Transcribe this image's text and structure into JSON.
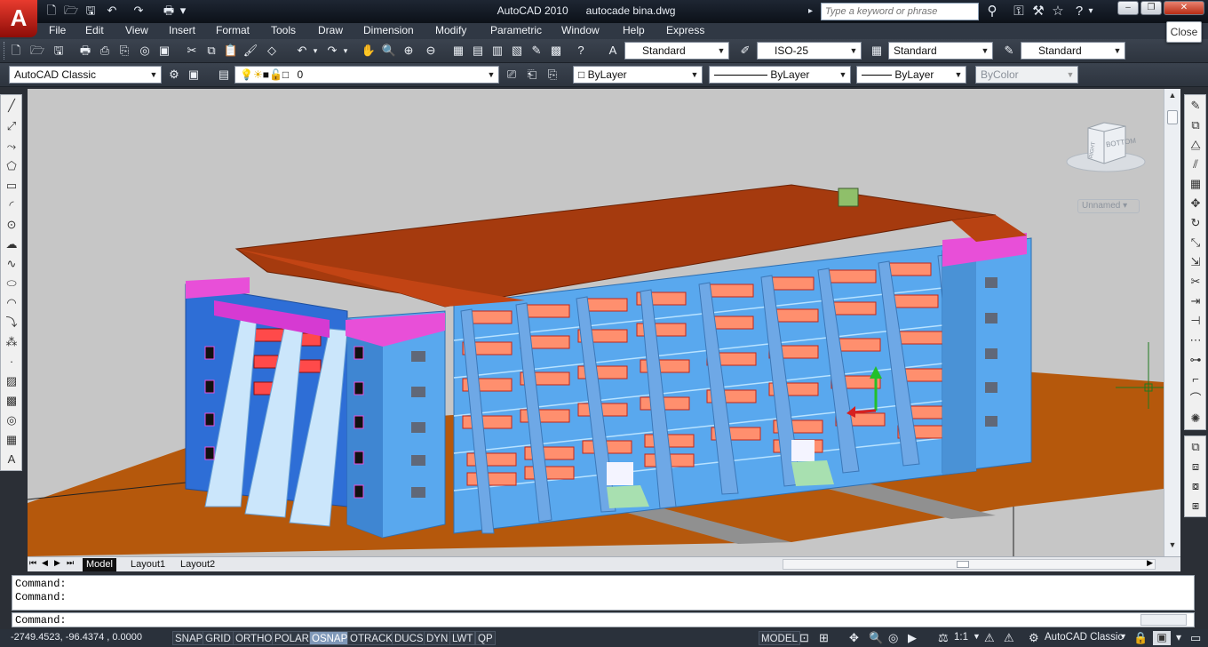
{
  "title": {
    "app": "AutoCAD 2010",
    "file": "autocade bina.dwg"
  },
  "search": {
    "placeholder": "Type a keyword or phrase"
  },
  "close_tooltip": "Close",
  "menu": [
    "File",
    "Edit",
    "View",
    "Insert",
    "Format",
    "Tools",
    "Draw",
    "Dimension",
    "Modify",
    "Parametric",
    "Window",
    "Help",
    "Express"
  ],
  "styles": {
    "text": "Standard",
    "dim": "ISO-25",
    "table": "Standard",
    "multileader": "Standard"
  },
  "workspace": "AutoCAD Classic",
  "layer": {
    "current": "0"
  },
  "properties": {
    "color": "ByLayer",
    "linetype": "ByLayer",
    "lineweight": "ByLayer",
    "plotstyle": "ByColor"
  },
  "viewcube": {
    "face_label": "BOTTOM",
    "side_label": "RIGHT",
    "ucs_label": "Unnamed"
  },
  "tabs": [
    "Model",
    "Layout1",
    "Layout2"
  ],
  "command": {
    "lines": [
      "Command:",
      "Command:"
    ],
    "prompt": "Command:"
  },
  "status": {
    "coords": "-2749.4523, -96.4374  , 0.0000",
    "toggles": [
      {
        "label": "SNAP",
        "on": false
      },
      {
        "label": "GRID",
        "on": false
      },
      {
        "label": "ORTHO",
        "on": false
      },
      {
        "label": "POLAR",
        "on": false
      },
      {
        "label": "OSNAP",
        "on": true
      },
      {
        "label": "OTRACK",
        "on": false
      },
      {
        "label": "DUCS",
        "on": false
      },
      {
        "label": "DYN",
        "on": false
      },
      {
        "label": "LWT",
        "on": false
      },
      {
        "label": "QP",
        "on": false
      }
    ],
    "space": "MODEL",
    "annotation_scale": "1:1",
    "workspace": "AutoCAD Classic"
  },
  "colors": {
    "roof": "#a53a0e",
    "wall": "#59a8ee",
    "ground": "#b5580c",
    "accent": "#e84fd8",
    "window": "#ff8f6e"
  }
}
